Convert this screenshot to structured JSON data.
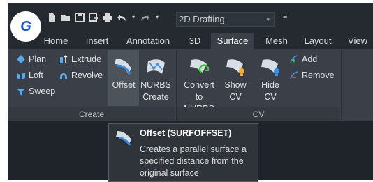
{
  "app": {
    "logo_letter": "G"
  },
  "quick_access": {
    "icons": [
      "new-file-icon",
      "open-folder-icon",
      "save-icon",
      "save-as-icon",
      "print-icon",
      "undo-icon",
      "redo-icon"
    ],
    "workspace": "2D Drafting"
  },
  "tabs": [
    "Home",
    "Insert",
    "Annotation",
    "3D",
    "Surface",
    "Mesh",
    "Layout",
    "View"
  ],
  "active_tab": "Surface",
  "create_panel": {
    "label": "Create",
    "small_buttons": [
      "Plan",
      "Loft",
      "Sweep",
      "Extrude",
      "Revolve"
    ],
    "offset": "Offset",
    "nurbs_line1": "NURBS",
    "nurbs_line2": "Create"
  },
  "cv_panel": {
    "label": "CV",
    "convert_line1": "Convert",
    "convert_line2": "to NURBS",
    "show_line1": "Show",
    "show_line2": "CV",
    "hide_line1": "Hide",
    "hide_line2": "CV",
    "add": "Add",
    "remove": "Remove"
  },
  "tooltip": {
    "title": "Offset (SURFOFFSET)",
    "line1": "Creates a parallel surface a",
    "line2": "specified distance from the",
    "line3": "original surface"
  },
  "colors": {
    "accent_blue": "#3a8ee6",
    "green": "#46c046",
    "yellow": "#f0b030",
    "red": "#e04a3a"
  }
}
